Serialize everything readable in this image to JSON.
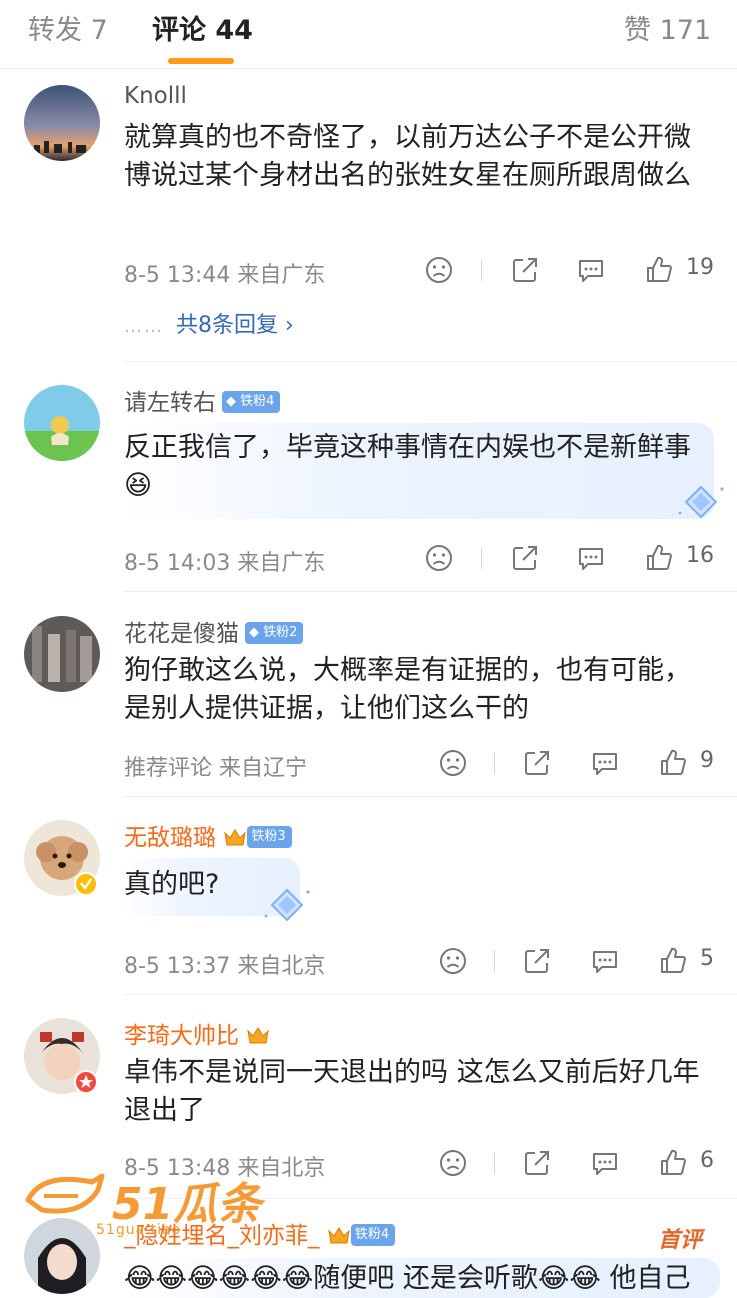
{
  "tabs": {
    "repost": "转发 7",
    "comments": "评论 44",
    "likes": "赞 171"
  },
  "comments": [
    {
      "author": "Knolll",
      "text": "就算真的也不奇怪了，以前万达公子不是公开微博说过某个身材出名的张姓女星在厕所跟周做么",
      "meta": "8-5 13:44  来自广东",
      "likes": "19",
      "replies": "共8条回复 ›",
      "reply_dots": "……"
    },
    {
      "author": "请左转右",
      "badge": "铁粉4",
      "text": "反正我信了，毕竟这种事情在内娱也不是新鲜事😆",
      "meta": "8-5 14:03  来自广东",
      "likes": "16"
    },
    {
      "author": "花花是傻猫",
      "badge": "铁粉2",
      "text": "狗仔敢这么说，大概率是有证据的，也有可能，是别人提供证据，让他们这么干的",
      "meta": "推荐评论  来自辽宁",
      "likes": "9"
    },
    {
      "author": "无敌璐璐",
      "badge": "铁粉3",
      "text": "真的吧?",
      "meta": "8-5 13:37  来自北京",
      "likes": "5"
    },
    {
      "author": "李琦大帅比",
      "text": "卓伟不是说同一天退出的吗 这怎么又前后好几年退出了",
      "meta": "8-5 13:48  来自北京",
      "likes": "6"
    },
    {
      "author": "_隐姓埋名_刘亦菲_",
      "badge": "铁粉4",
      "pick": "首评",
      "text": "😂😂😂😂😂😂随便吧 还是会听歌😂😂 他自己"
    }
  ],
  "watermark": {
    "main": "51瓜条",
    "sub": "51gua.tiao"
  },
  "colors": {
    "accent": "#ff9a16",
    "vip_name": "#f36b19",
    "link": "#3668b4",
    "fan_badge": "#6aa4ea"
  },
  "icons": [
    "dislike-icon",
    "share-icon",
    "comment-icon",
    "thumbs-up-icon",
    "chevron-right-icon",
    "crown-icon",
    "diamond-icon"
  ]
}
